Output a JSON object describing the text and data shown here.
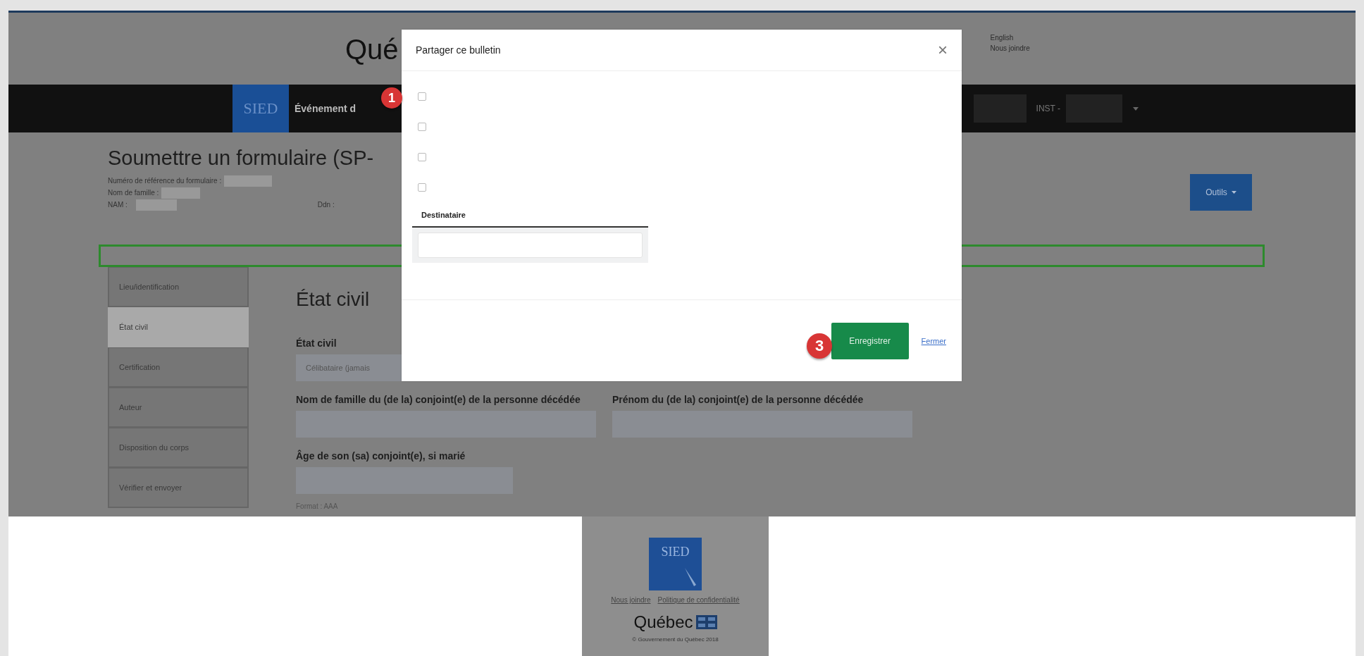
{
  "header": {
    "title": "Qué",
    "links": [
      "English",
      "Nous joindre"
    ]
  },
  "nav": {
    "logo": "SIED",
    "item": "Événement d",
    "institution": "INST -"
  },
  "form": {
    "title": "Soumettre un formulaire (SP-",
    "meta": [
      "Numéro de référence du formulaire :",
      "Nom de famille :",
      "NAM :"
    ],
    "dob_label": "Ddn :",
    "tools_button": "Outils"
  },
  "sidebar": {
    "items": [
      {
        "label": "Lieu/identification",
        "selected": false
      },
      {
        "label": "État civil",
        "selected": true
      },
      {
        "label": "Certification",
        "selected": false
      },
      {
        "label": "Auteur",
        "selected": false
      },
      {
        "label": "Disposition du corps",
        "selected": false
      },
      {
        "label": "Vérifier et envoyer",
        "selected": false
      }
    ]
  },
  "section": {
    "heading": "État civil",
    "rows": [
      {
        "fields": [
          {
            "label": "État civil",
            "value": "Célibataire (jamais"
          }
        ]
      },
      {
        "fields": [
          {
            "label": "Nom de famille du (de la) conjoint(e) de la personne décédée"
          },
          {
            "label": "Prénom du (de la) conjoint(e) de la personne décédée"
          }
        ]
      },
      {
        "fields": [
          {
            "label": "Âge de son (sa) conjoint(e), si marié",
            "hint": "Format : AAA"
          }
        ]
      }
    ]
  },
  "modal": {
    "title": "Partager ce bulletin",
    "close_icon": "×",
    "checkboxes": [
      {
        "checked": false
      },
      {
        "checked": false
      },
      {
        "checked": false
      },
      {
        "checked": false
      }
    ],
    "recipient_label": "Destinataire",
    "save_button": "Enregistrer",
    "close_link": "Fermer"
  },
  "callouts": [
    {
      "number": "1"
    },
    {
      "number": "3"
    }
  ],
  "footer": {
    "logo": "SIED",
    "links": [
      "Nous joindre",
      "Politique de confidentialité"
    ],
    "brand": "Québec",
    "copyright": "© Gouvernement du Québec 2018"
  }
}
